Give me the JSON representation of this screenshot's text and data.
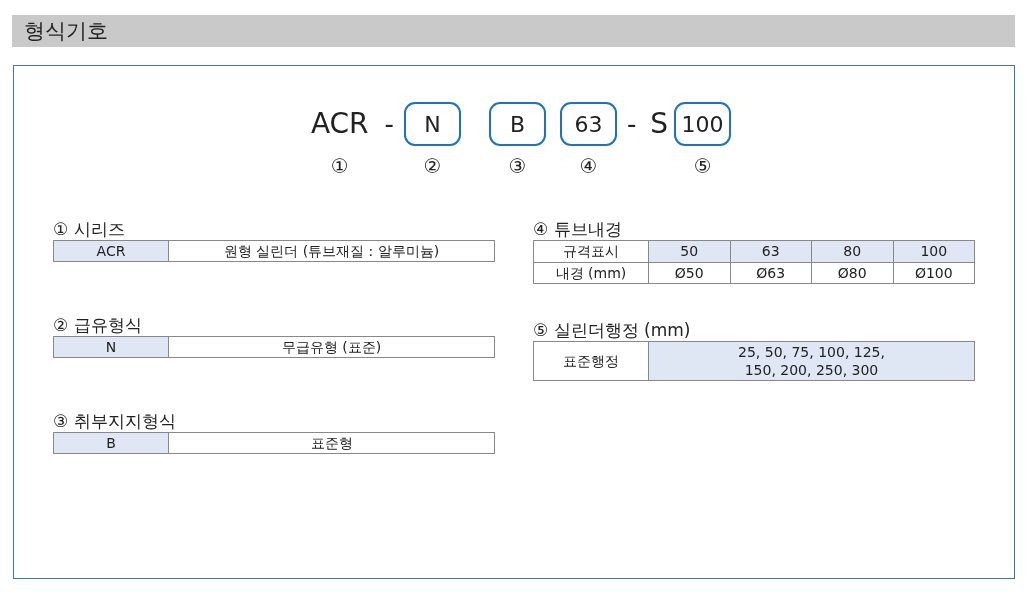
{
  "header": {
    "title": "형식기호"
  },
  "code": {
    "parts": [
      {
        "text": "ACR",
        "kind": "plain",
        "marker": "①"
      },
      {
        "text": "-",
        "kind": "separator"
      },
      {
        "text": "N",
        "kind": "boxed",
        "marker": "②"
      },
      {
        "text": "B",
        "kind": "boxed",
        "marker": "③"
      },
      {
        "text": "63",
        "kind": "boxed",
        "marker": "④"
      },
      {
        "text": "-",
        "kind": "separator"
      },
      {
        "text": "S",
        "kind": "plain"
      },
      {
        "text": "100",
        "kind": "boxed",
        "marker": "⑤"
      }
    ]
  },
  "left_sections": [
    {
      "title": "① 시리즈",
      "code": "ACR",
      "description": "원형 실린더 (튜브재질 : 알루미늄)"
    },
    {
      "title": "② 급유형식",
      "code": "N",
      "description": "무급유형 (표준)"
    },
    {
      "title": "③ 취부지지형식",
      "code": "B",
      "description": "표준형"
    }
  ],
  "tube_bore": {
    "title": "④ 튜브내경",
    "rows": [
      {
        "label": "규격표시",
        "highlighted": true,
        "values": [
          "50",
          "63",
          "80",
          "100"
        ]
      },
      {
        "label": "내경 (mm)",
        "highlighted": false,
        "values": [
          "Ø50",
          "Ø63",
          "Ø80",
          "Ø100"
        ]
      }
    ]
  },
  "stroke": {
    "title": "⑤ 실린더행정 (mm)",
    "label": "표준행정",
    "lines": [
      "25, 50, 75, 100, 125,",
      "150, 200, 250, 300"
    ]
  }
}
